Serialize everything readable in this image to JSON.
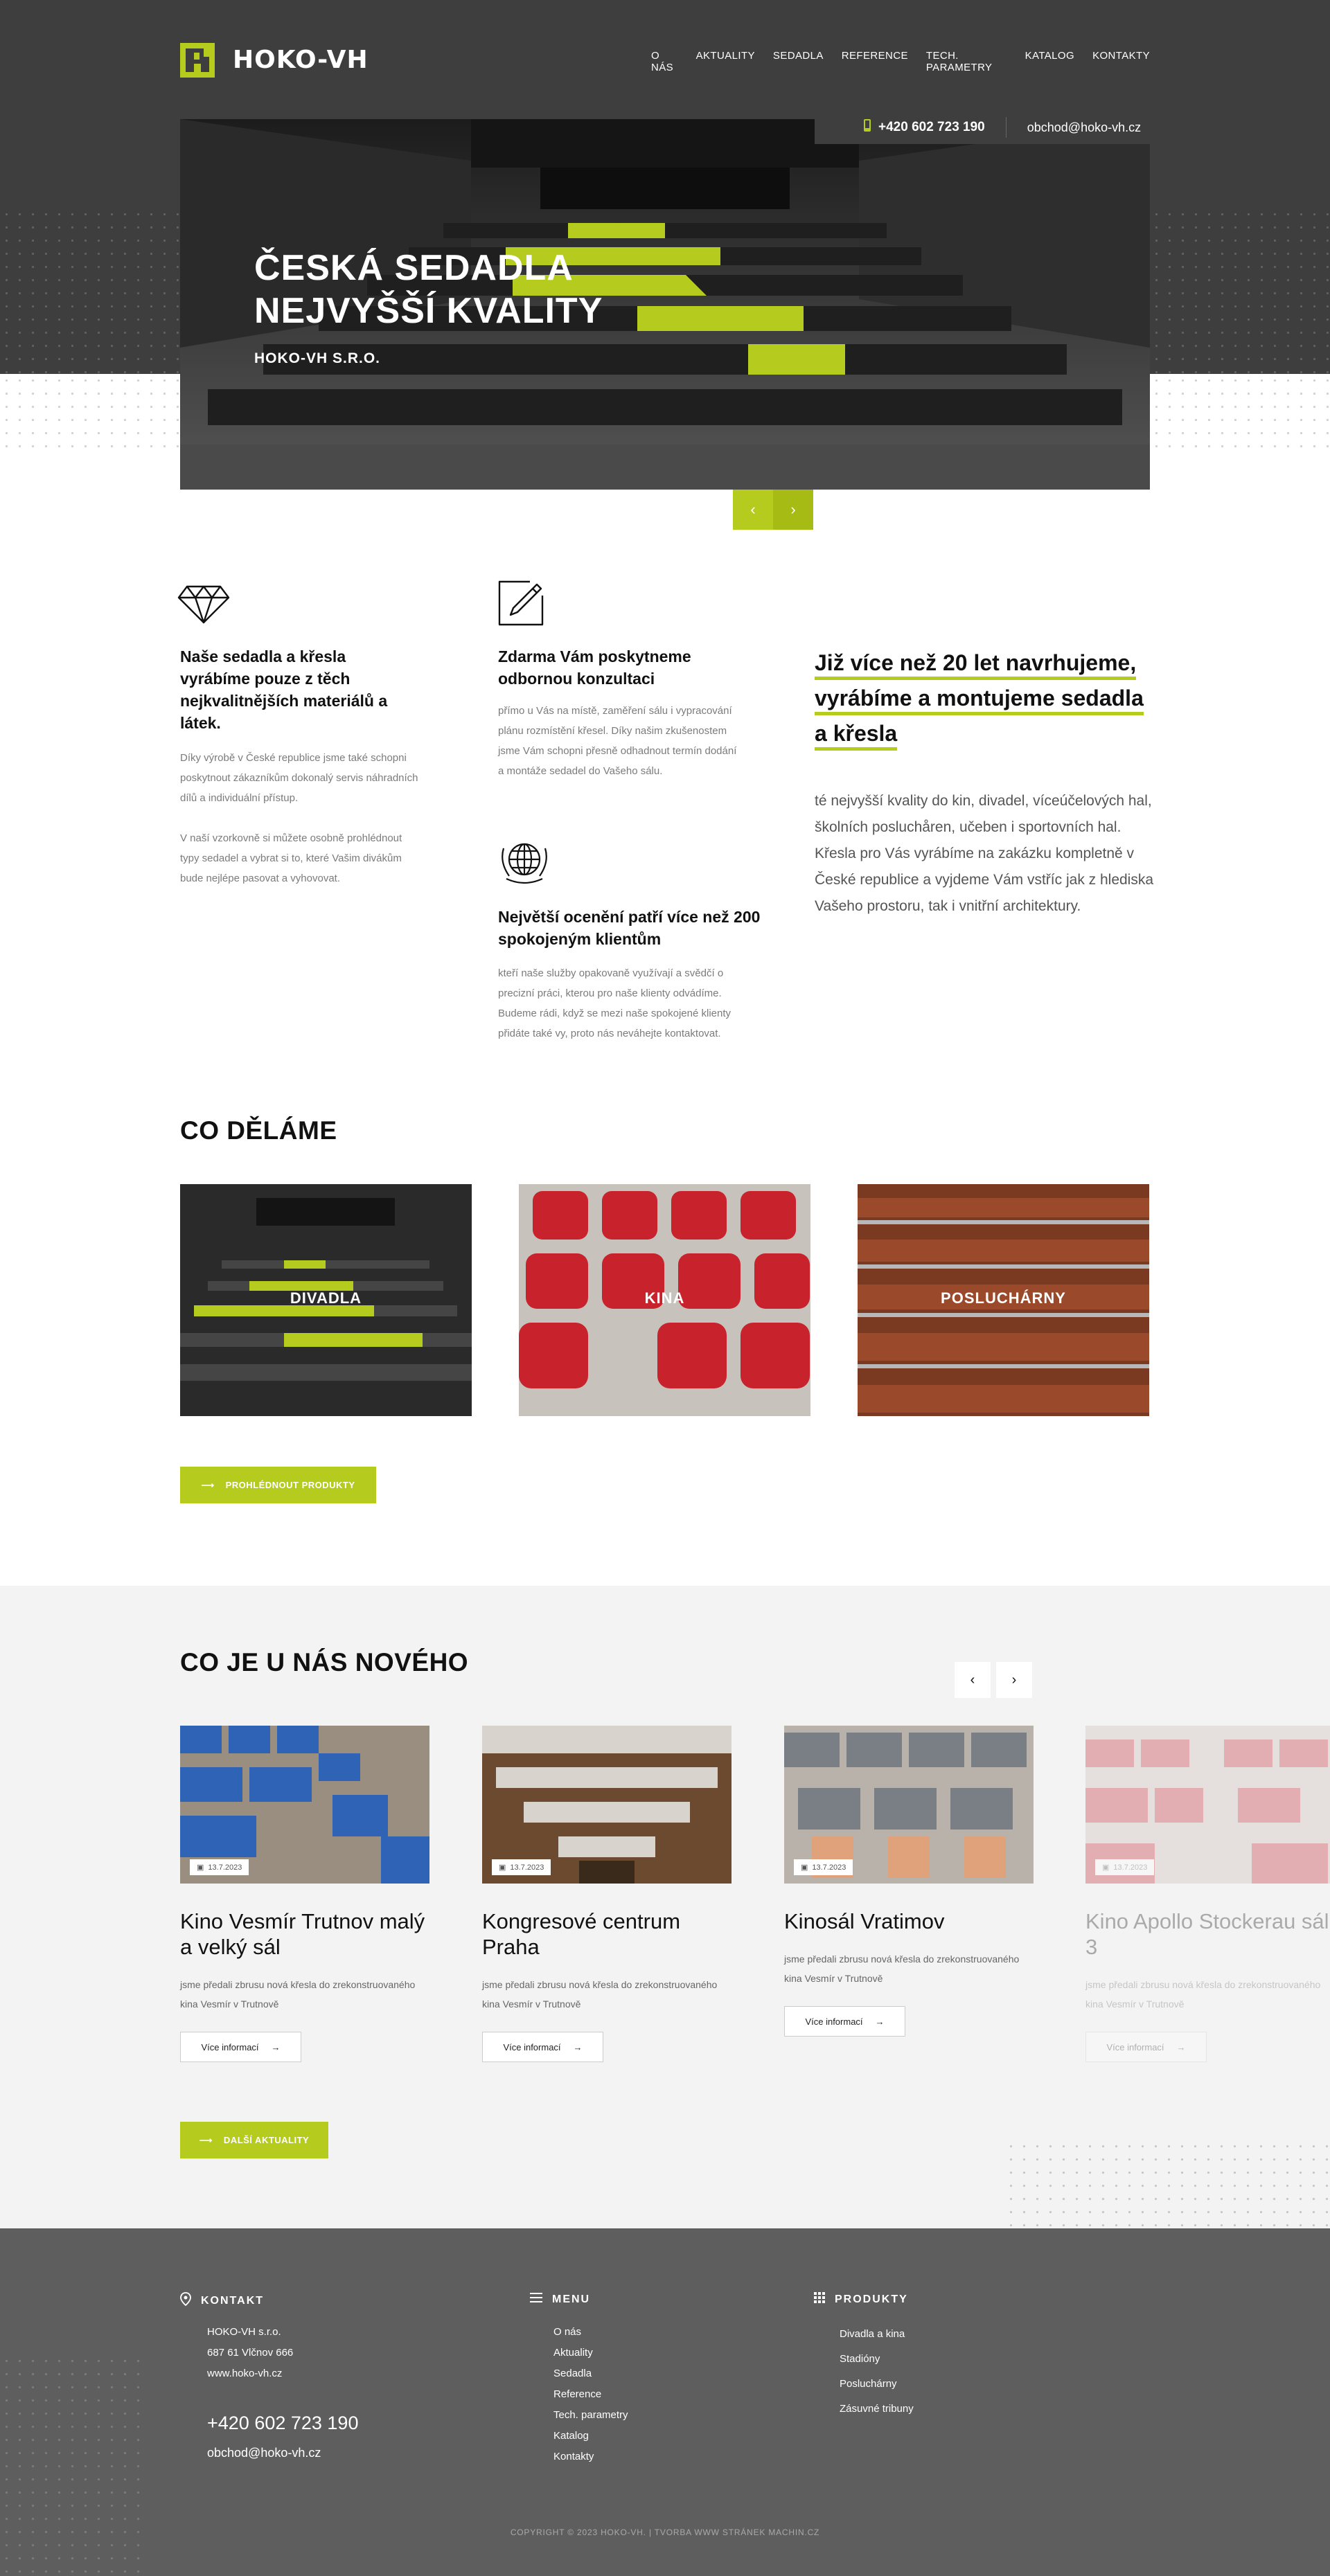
{
  "brand": {
    "name": "HOKO-VH",
    "accent": "#b5cc1e",
    "dark": "#3e3e3e"
  },
  "nav": [
    "O NÁS",
    "AKTUALITY",
    "SEDADLA",
    "REFERENCE",
    "TECH. PARAMETRY",
    "KATALOG",
    "KONTAKTY"
  ],
  "contact_top": {
    "phone": "+420 602 723 190",
    "email": "obchod@hoko-vh.cz",
    "phone_icon": "phone-icon"
  },
  "hero": {
    "title_line1": "ČESKÁ SEDADLA",
    "title_line2": "NEJVYŠŠÍ KVALITY",
    "subtitle": "HOKO-VH S.R.O.",
    "prev": "‹",
    "next": "›"
  },
  "features": [
    {
      "icon": "diamond-icon",
      "title": "Naše sedadla a křesla vyrábíme pouze z těch nejkvalitnějších materiálů a látek.",
      "text1": "Díky výrobě v České republice jsme také schopni poskytnout zákazníkům dokonalý servis náhradních dílů a individuální přístup.",
      "text2": "V naší vzorkovně si můžete osobně prohlédnout typy sedadel a vybrat si to, které Vašim divákům bude nejlépe pasovat a vyhovovat."
    },
    {
      "icon": "pencil-icon",
      "title": "Zdarma Vám poskytneme odbornou konzultaci",
      "text1": "přímo u Vás na místě, zaměření sálu i vypracování plánu rozmístění křesel. Díky našim zkušenostem jsme Vám schopni přesně odhadnout termín dodání a montáže sedadel do Vašeho sálu."
    },
    {
      "icon": "globe-icon",
      "title": "Největší ocenění patří více než 200 spokojeným klientům",
      "text1": "kteří naše služby opakovaně využívají a svědčí o precizní práci, kterou pro naše klienty odvádíme. Budeme rádi, když se mezi naše spokojené klienty přidáte také vy, proto nás neváhejte kontaktovat."
    }
  ],
  "about": {
    "title": "Již více než 20 let navrhujeme, vyrábíme a montujeme sedadla a křesla",
    "text": "té nejvyšší kvality do kin, divadel, víceúčelových hal, školních posluchåren, učeben i sportovních hal. Křesla pro Vás vyrábíme na zakázku kompletně v České republice a vyjdeme Vám vstříc jak z hlediska Vašeho prostoru, tak i vnitřní architektury."
  },
  "what_we_do": {
    "title": "CO DĚLÁME",
    "categories": [
      "DIVADLA",
      "KINA",
      "POSLUCHÁRNY"
    ],
    "button": "PROHLÉDNOUT PRODUKTY"
  },
  "news": {
    "title": "CO JE U NÁS NOVÉHO",
    "prev": "‹",
    "next": "›",
    "items": [
      {
        "date": "13.7.2023",
        "title": "Kino Vesmír Trutnov malý a velký sál",
        "text": "jsme předali zbrusu nová křesla do zrekonstruovaného kina Vesmír v Trutnově",
        "more": "Více informací"
      },
      {
        "date": "13.7.2023",
        "title": "Kongresové centrum Praha",
        "text": "jsme předali zbrusu nová křesla do zrekonstruovaného kina Vesmír v Trutnově",
        "more": "Více informací"
      },
      {
        "date": "13.7.2023",
        "title": "Kinosál Vratimov",
        "text": "jsme předali zbrusu nová křesla do zrekonstruovaného kina Vesmír v Trutnově",
        "more": "Více informací"
      },
      {
        "date": "13.7.2023",
        "title": "Kino Apollo Stockerau sál 3",
        "text": "jsme předali zbrusu nová křesla do zrekonstruovaného kina Vesmír v Trutnově",
        "more": "Více informací"
      }
    ],
    "button": "DALŠÍ AKTUALITY"
  },
  "footer": {
    "contact_head": "KONTAKT",
    "company": "HOKO-VH s.r.o.",
    "address": "687 61 Vlčnov 666",
    "web": "www.hoko-vh.cz",
    "phone": "+420 602 723 190",
    "email": "obchod@hoko-vh.cz",
    "menu_head": "MENU",
    "menu": [
      "O nás",
      "Aktuality",
      "Sedadla",
      "Reference",
      "Tech. parametry",
      "Katalog",
      "Kontakty"
    ],
    "products_head": "PRODUKTY",
    "products": [
      "Divadla a kina",
      "Stadióny",
      "Posluchárny",
      "Zásuvné tribuny"
    ],
    "copyright": "COPYRIGHT © 2023 HOKO-VH. | TVORBA WWW STRÁNEK MACHIN.CZ"
  }
}
